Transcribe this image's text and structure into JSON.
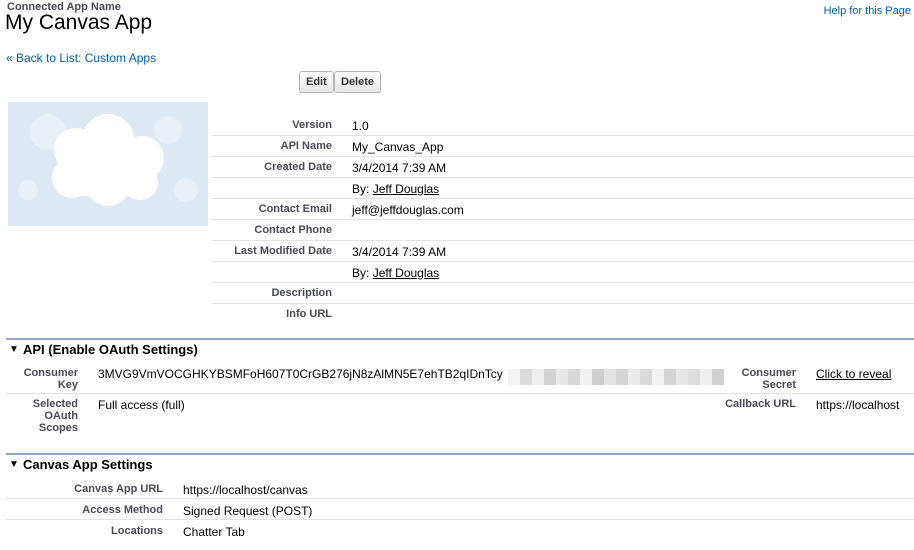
{
  "header": {
    "page_type": "Connected App Name",
    "title": "My Canvas App",
    "help_link": "Help for this Page",
    "back_link": "« Back to List: Custom Apps"
  },
  "buttons": {
    "edit": "Edit",
    "delete": "Delete"
  },
  "logo": {
    "icon": "cloud-icon"
  },
  "details": {
    "version": {
      "label": "Version",
      "value": "1.0"
    },
    "api_name": {
      "label": "API Name",
      "value": "My_Canvas_App"
    },
    "created_date": {
      "label": "Created Date",
      "value": "3/4/2014 7:39 AM",
      "by_prefix": "By:",
      "by_user": "Jeff Douglas"
    },
    "contact_email": {
      "label": "Contact Email",
      "value": "jeff@jeffdouglas.com"
    },
    "contact_phone": {
      "label": "Contact Phone",
      "value": ""
    },
    "last_modified_date": {
      "label": "Last Modified Date",
      "value": "3/4/2014 7:39 AM",
      "by_prefix": "By:",
      "by_user": "Jeff Douglas"
    },
    "description": {
      "label": "Description",
      "value": ""
    },
    "info_url": {
      "label": "Info URL",
      "value": ""
    }
  },
  "api_section": {
    "title": "API (Enable OAuth Settings)",
    "consumer_key_label": "Consumer Key",
    "consumer_key_value": "3MVG9VmVOCGHKYBSMFoH607T0CrGB276jN8zAlMN5E7ehTB2qIDnTcy",
    "consumer_secret_label": "Consumer Secret",
    "consumer_secret_link": "Click to reveal",
    "oauth_scopes_label": "Selected OAuth Scopes",
    "oauth_scopes_value": "Full access (full)",
    "callback_url_label": "Callback URL",
    "callback_url_value": "https://localhost"
  },
  "canvas_section": {
    "title": "Canvas App Settings",
    "rows": [
      {
        "label": "Canvas App URL",
        "value": "https://localhost/canvas"
      },
      {
        "label": "Access Method",
        "value": "Signed Request (POST)"
      },
      {
        "label": "Locations",
        "value": "Chatter Tab"
      }
    ]
  },
  "colors": {
    "link": "#015ba7",
    "label": "#4a4a56",
    "section_border": "#8fa6c4",
    "logo_bg": "#dfe9f3"
  }
}
